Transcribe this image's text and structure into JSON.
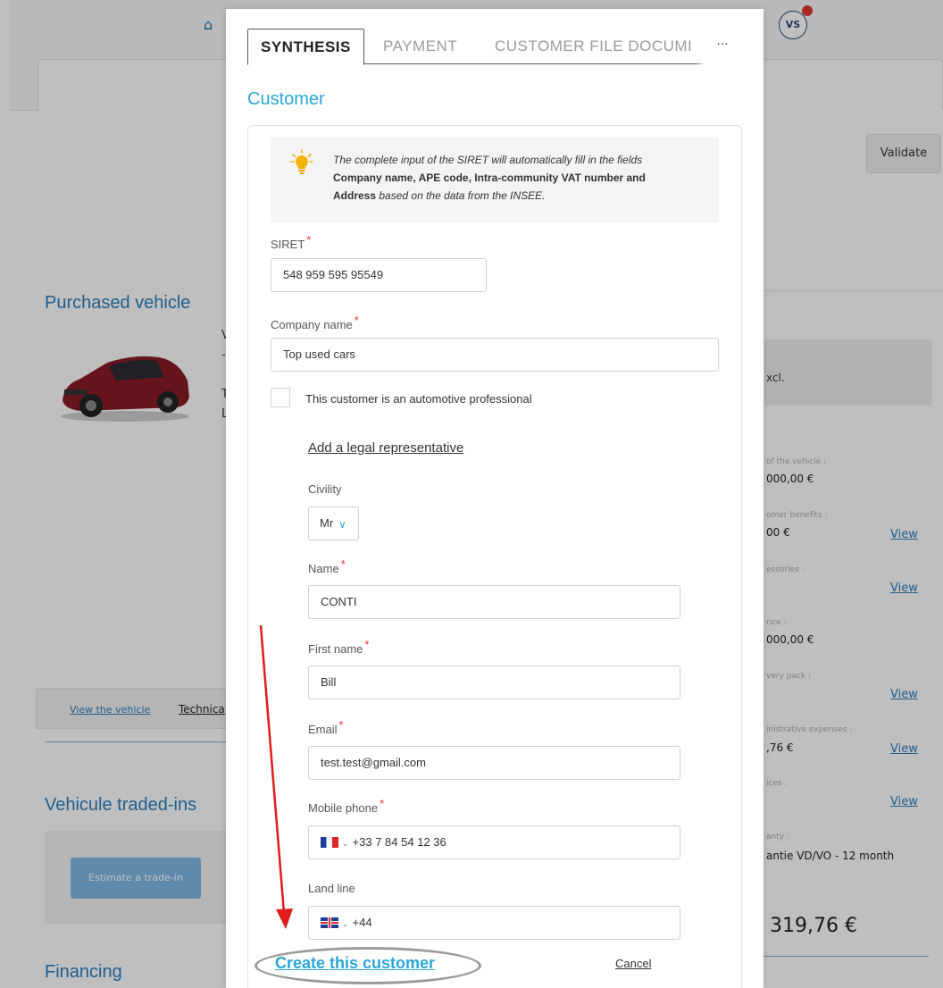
{
  "background": {
    "validate_label": "Validate",
    "avatar_initials": "VS",
    "purchased_vehicle_title": "Purchased vehicle",
    "vehicle_traded_ins_title": "Vehicule traded-ins",
    "financing_title": "Financing",
    "view_vehicle_link": "View the vehicle",
    "technical_link": "Technica",
    "estimate_trade_in_label": "Estimate a trade-in",
    "excl_text": "xcl.",
    "price_rows": [
      {
        "label": "of the vehicle :",
        "value": "000,00 €",
        "view": ""
      },
      {
        "label": "omer benefits :",
        "value": "00 €",
        "view": "View"
      },
      {
        "label": "essories :",
        "value": "",
        "view": "View"
      },
      {
        "label": "rice :",
        "value": "000,00 €",
        "view": ""
      },
      {
        "label": "very pack :",
        "value": "",
        "view": "View"
      },
      {
        "label": "inistrative expenses :",
        "value": ",76 €",
        "view": "View"
      },
      {
        "label": "ices :",
        "value": "",
        "view": "View"
      },
      {
        "label": "anty :",
        "value": "antie VD/VO - 12 month",
        "view": ""
      }
    ],
    "total_value": "319,76 €"
  },
  "modal": {
    "tabs": [
      {
        "label": "SYNTHESIS",
        "active": true
      },
      {
        "label": "PAYMENT",
        "active": false
      },
      {
        "label": "CUSTOMER FILE DOCUMI",
        "active": false
      }
    ],
    "tabs_more": "···",
    "section_title": "Customer",
    "info": {
      "line1": "The complete input of the SIRET will automatically fill in the fields",
      "line2": "Company name, APE code, Intra-community VAT number and",
      "line3_bold": "Address",
      "line3_rest": " based on the data from the INSEE."
    },
    "siret": {
      "label": "SIRET",
      "value": "548 959 595 95549"
    },
    "company_name": {
      "label": "Company name",
      "value": "Top used cars"
    },
    "professional_checkbox": {
      "label": "This customer is an automotive professional",
      "checked": false
    },
    "add_legal_rep": "Add a legal representative",
    "civility": {
      "label": "Civility",
      "value": "Mr"
    },
    "name": {
      "label": "Name",
      "value": "CONTI"
    },
    "first_name": {
      "label": "First name",
      "value": "Bill"
    },
    "email": {
      "label": "Email",
      "value": "test.test@gmail.com"
    },
    "mobile_phone": {
      "label": "Mobile phone",
      "value": "+33 7 84 54 12 36",
      "flag": "france-flag-icon"
    },
    "land_line": {
      "label": "Land line",
      "value": "+44",
      "flag": "uk-flag-icon"
    },
    "required_mark": "*",
    "create_button": "Create this customer",
    "cancel_button": "Cancel"
  },
  "colors": {
    "accent": "#2aa7d6",
    "required": "#e03434",
    "arrow": "#e01c1c"
  }
}
